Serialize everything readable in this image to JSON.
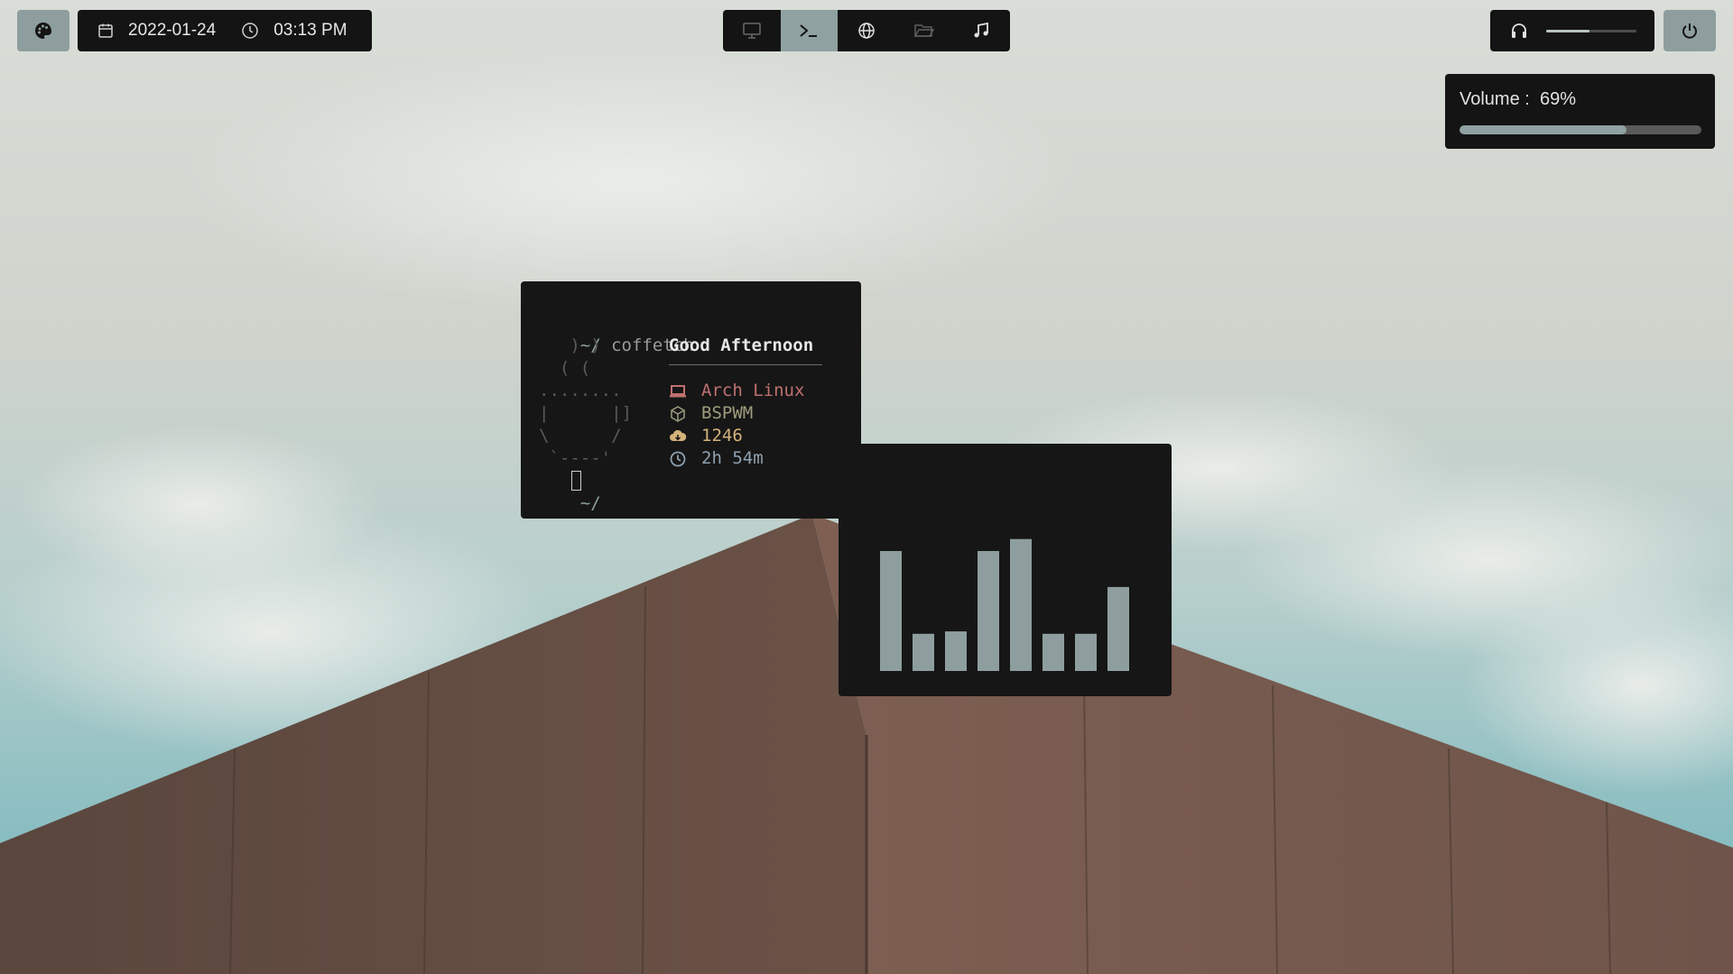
{
  "topbar": {
    "palette_icon": "palette-icon",
    "date": "2022-01-24",
    "time": "03:13 PM",
    "calendar_icon": "calendar-icon",
    "clock_icon": "clock-icon",
    "workspaces": [
      {
        "icon": "monitor-icon",
        "active": false
      },
      {
        "icon": "terminal-icon",
        "active": true
      },
      {
        "icon": "globe-icon",
        "active": false
      },
      {
        "icon": "folder-icon",
        "active": false
      },
      {
        "icon": "music-note-icon",
        "active": false
      }
    ],
    "headphones_icon": "headphones-icon",
    "power_icon": "power-icon"
  },
  "volume": {
    "label": "Volume :",
    "percent_text": "69%",
    "level": 0.69
  },
  "terminal": {
    "prompt": "~/",
    "command": "coffetch",
    "ascii_art": [
      "   ) )",
      "  ( (",
      "........",
      "|      |]",
      "\\      /",
      " `----'"
    ],
    "greeting": "Good Afternoon",
    "info": [
      {
        "icon": "laptop-icon",
        "text": "Arch Linux",
        "color": "#c07070"
      },
      {
        "icon": "cube-icon",
        "text": "BSPWM",
        "color": "#9d9d7e"
      },
      {
        "icon": "cloud-download-icon",
        "text": "1246",
        "color": "#d4b37a"
      },
      {
        "icon": "clock-icon",
        "text": "2h 54m",
        "color": "#8fa1b0"
      }
    ],
    "prompt2": "~/"
  },
  "visualizer": {
    "levels": [
      1.0,
      0.31,
      0.33,
      1.0,
      1.1,
      0.31,
      0.31,
      0.7
    ],
    "color": "#8e9e9e"
  },
  "colors": {
    "bar_bg": "#141414",
    "accent": "#8fa1a1",
    "text": "#e7e7e7"
  }
}
